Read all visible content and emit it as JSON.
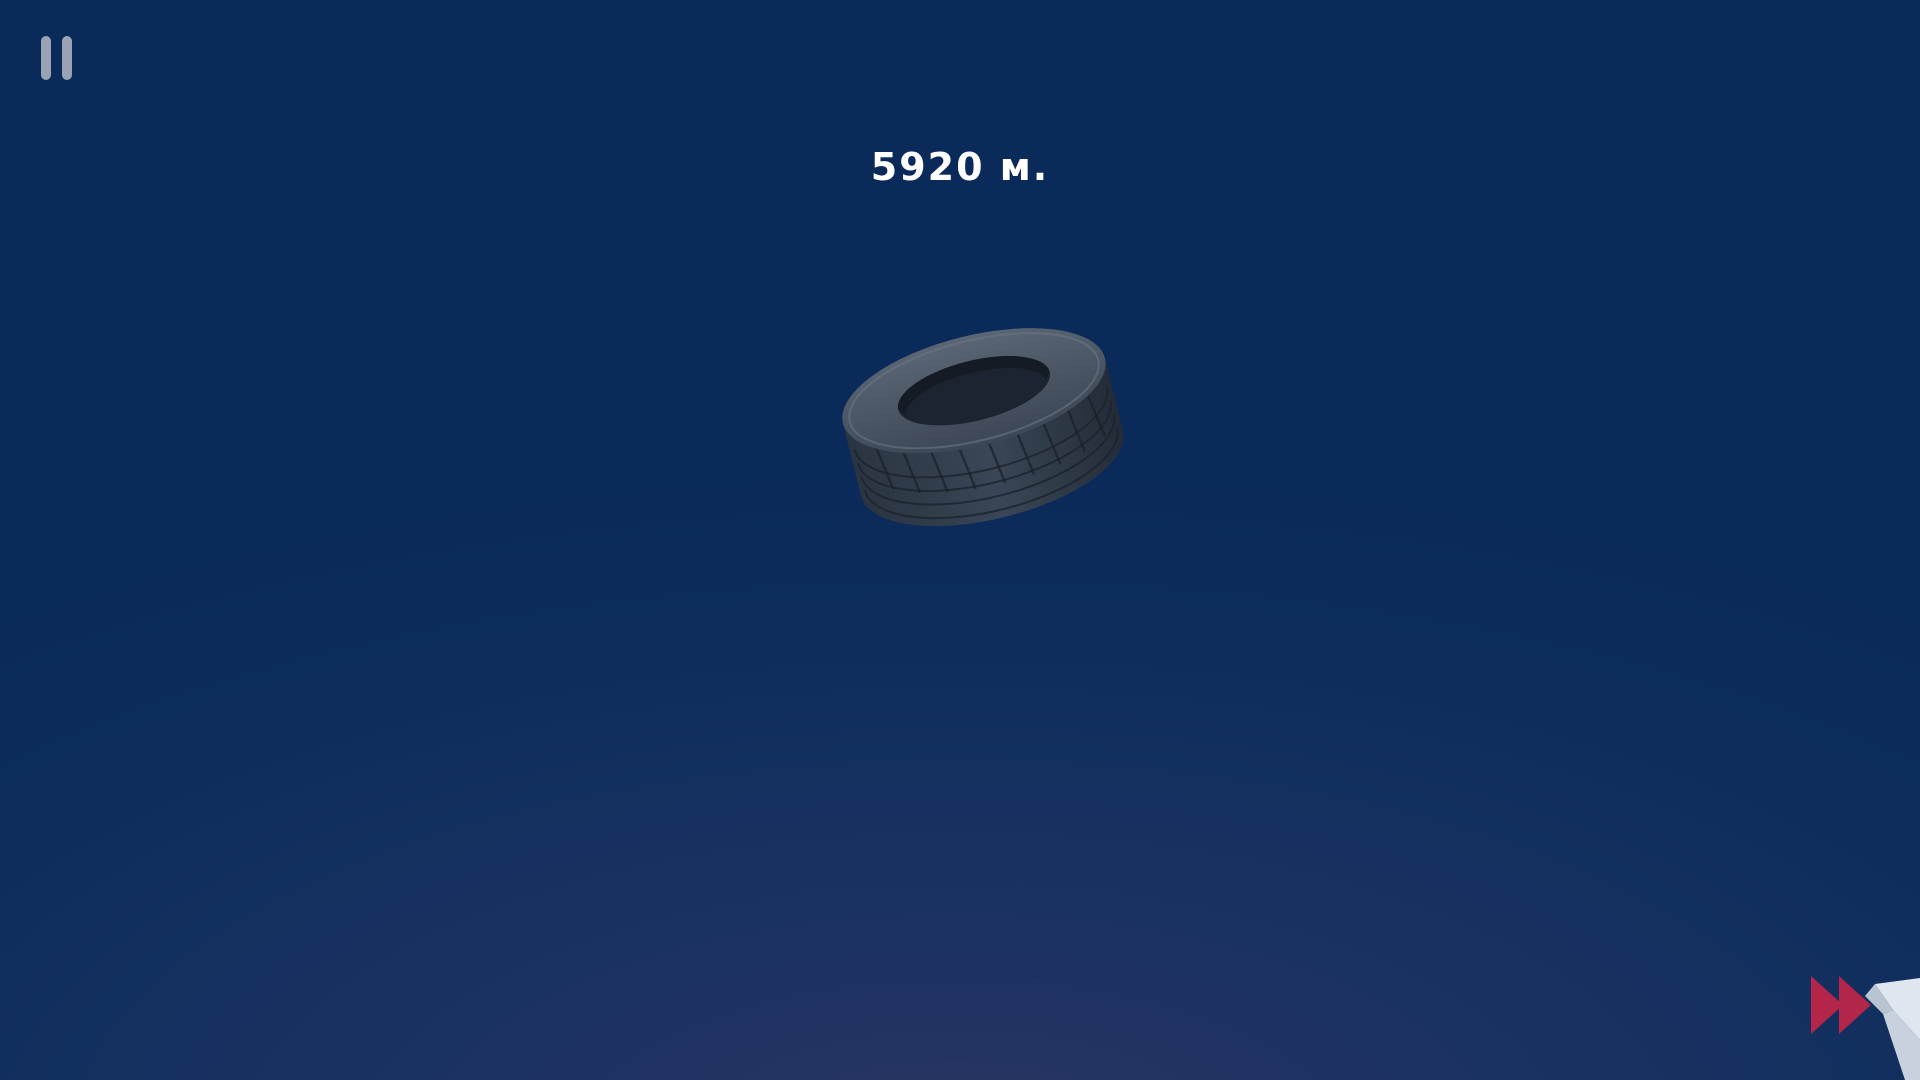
{
  "hud": {
    "distance": "5920 м."
  },
  "icons": {
    "pause": "pause-icon",
    "fast_forward": "fast-forward-icon",
    "tire": "tire"
  },
  "colors": {
    "sky_top": "#0a2a5a",
    "sky_bottom": "#2b3561",
    "pause_icon": "#9aa3b3",
    "fast_forward": "#b3264a",
    "text": "#ffffff"
  }
}
